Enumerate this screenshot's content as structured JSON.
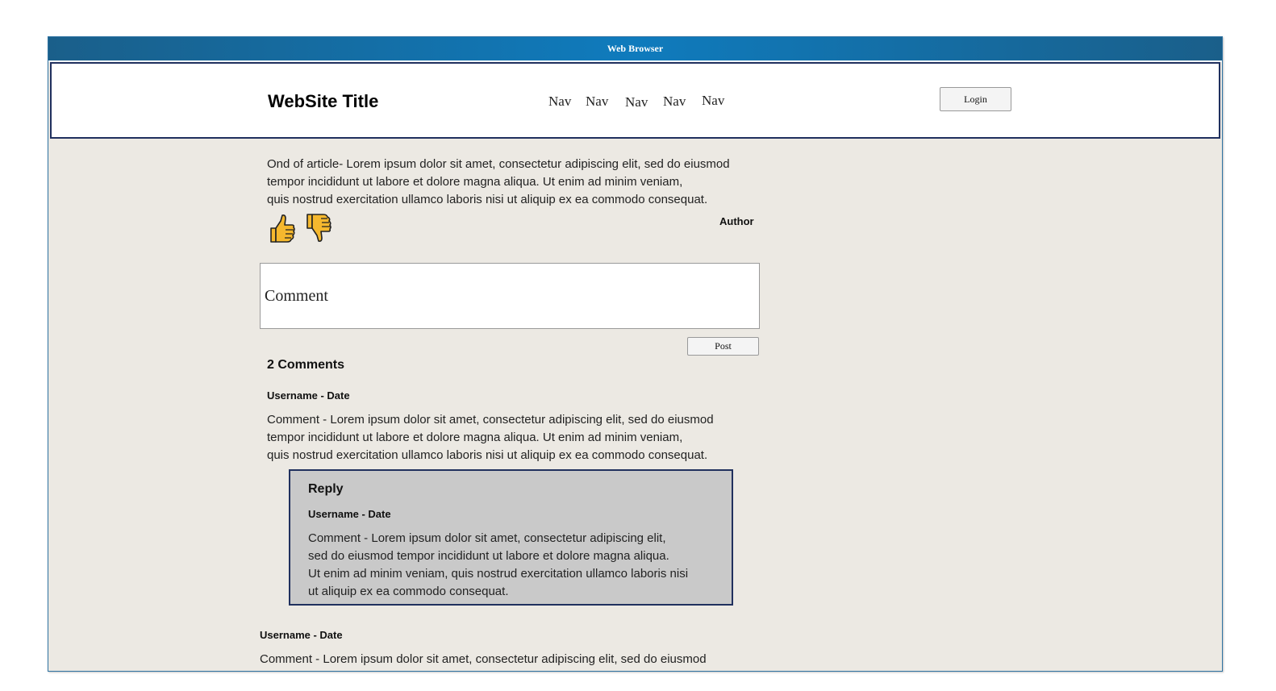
{
  "browser": {
    "title": "Web Browser"
  },
  "header": {
    "site_title": "WebSite Title",
    "nav": [
      "Nav",
      "Nav",
      "Nav",
      "Nav",
      "Nav"
    ],
    "login_label": "Login"
  },
  "article": {
    "text": "Ond of article- Lorem ipsum dolor sit amet, consectetur adipiscing elit, sed do eiusmod\ntempor incididunt ut labore et dolore magna aliqua. Ut enim ad minim veniam,\nquis nostrud exercitation ullamco laboris nisi ut aliquip ex ea commodo consequat.",
    "author": "Author",
    "like_icon": "thumbs-up-icon",
    "dislike_icon": "thumbs-down-icon",
    "icon_color": "#f5b82e"
  },
  "comment_form": {
    "placeholder": "Comment",
    "post_label": "Post"
  },
  "comments": {
    "count_label": "2 Comments",
    "items": [
      {
        "meta": "Username - Date",
        "text": "Comment - Lorem ipsum dolor sit amet, consectetur adipiscing elit, sed do eiusmod\ntempor incididunt ut labore et dolore magna aliqua. Ut enim ad minim veniam,\nquis nostrud exercitation ullamco laboris nisi ut aliquip ex ea commodo consequat.",
        "reply": {
          "title": "Reply",
          "meta": "Username - Date",
          "text": "Comment - Lorem ipsum dolor sit amet, consectetur adipiscing elit,\nsed do eiusmod tempor incididunt ut labore et dolore magna aliqua.\nUt enim ad minim veniam, quis nostrud exercitation ullamco laboris nisi\nut aliquip ex ea commodo consequat."
        }
      },
      {
        "meta": "Username - Date",
        "text": "Comment - Lorem ipsum dolor sit amet, consectetur adipiscing elit, sed do eiusmod"
      }
    ]
  }
}
